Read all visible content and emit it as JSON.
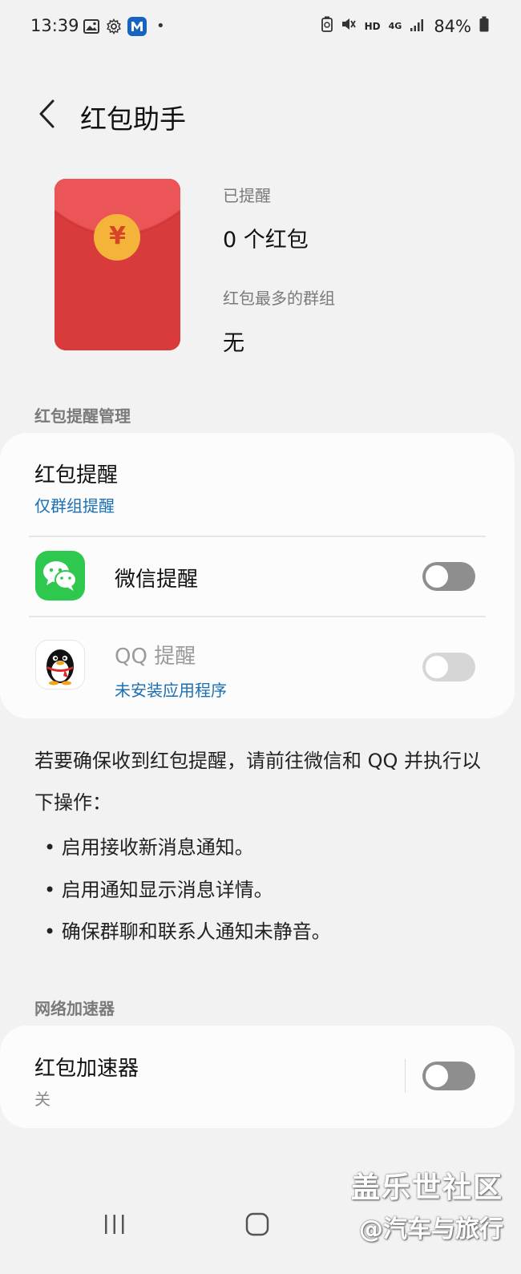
{
  "status_bar": {
    "time": "13:39",
    "network": "HD",
    "signal_type": "4G",
    "battery": "84%",
    "dot": "•"
  },
  "header": {
    "title": "红包助手"
  },
  "summary": {
    "reminded_label": "已提醒",
    "reminded_value": "0 个红包",
    "top_group_label": "红包最多的群组",
    "top_group_value": "无",
    "envelope_symbol": "¥"
  },
  "reminder_section": {
    "header": "红包提醒管理",
    "main_title": "红包提醒",
    "main_sub": "仅群组提醒",
    "wechat_label": "微信提醒",
    "wechat_toggle_on": false,
    "qq_label": "QQ 提醒",
    "qq_sub": "未安装应用程序",
    "qq_toggle_on": false
  },
  "info": {
    "intro": "若要确保收到红包提醒，请前往微信和 QQ 并执行以下操作：",
    "bullets": [
      "启用接收新消息通知。",
      "启用通知显示消息详情。",
      "确保群聊和联系人通知未静音。"
    ],
    "bullet_char": "•"
  },
  "accelerator_section": {
    "header": "网络加速器",
    "title": "红包加速器",
    "sub": "关",
    "toggle_on": false
  },
  "watermark": {
    "line1": "盖乐世社区",
    "line2": "@汽车与旅行"
  },
  "colors": {
    "background": "#f2f2f2",
    "card": "#fcfcfc",
    "link_blue": "#1a6fb3",
    "envelope_red": "#d93a3c",
    "coin_gold": "#f4b43a",
    "wechat_green": "#2dc84d"
  }
}
